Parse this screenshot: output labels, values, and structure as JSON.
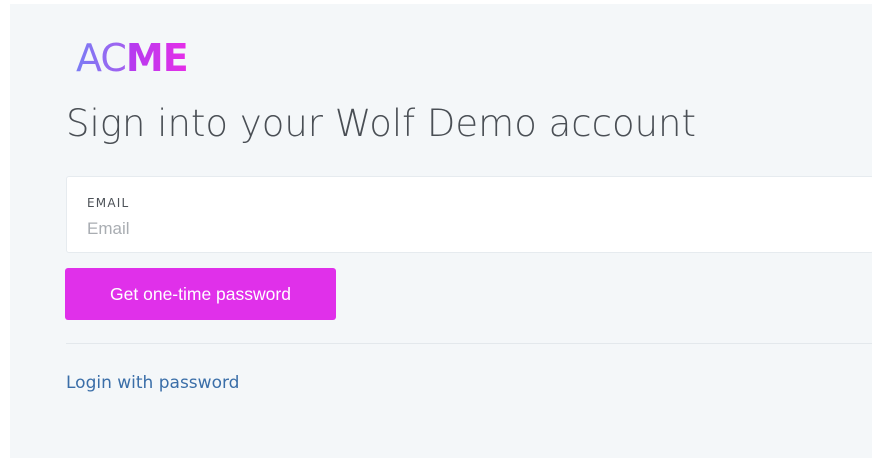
{
  "brand": {
    "logo_part1": "AC",
    "logo_part2": "ME",
    "accent_color": "#e030ea"
  },
  "page": {
    "title": "Sign into your Wolf Demo account"
  },
  "email_field": {
    "label": "EMAIL",
    "placeholder": "Email",
    "value": ""
  },
  "actions": {
    "otp_button_label": "Get one-time password",
    "password_link_label": "Login with password",
    "link_color": "#3a6ea8"
  }
}
